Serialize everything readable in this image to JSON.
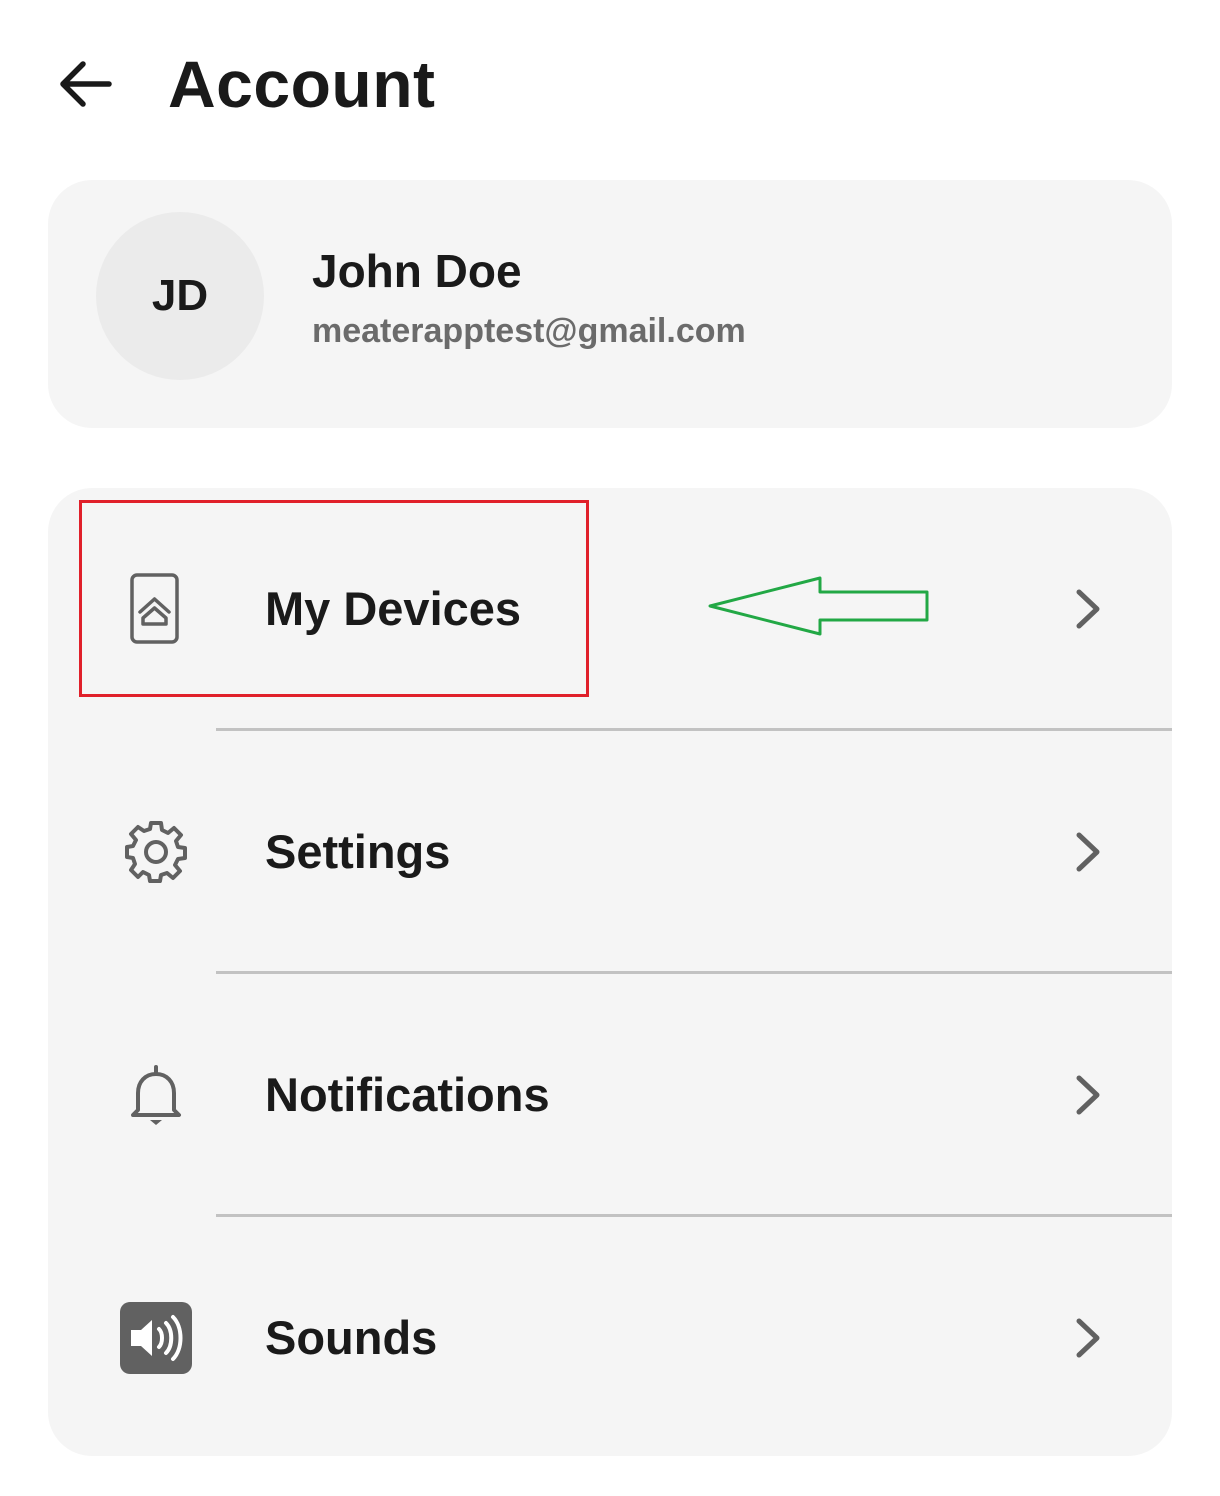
{
  "header": {
    "back_icon": "arrow-left-icon",
    "title": "Account"
  },
  "profile": {
    "initials": "JD",
    "name": "John Doe",
    "email": "meaterapptest@gmail.com"
  },
  "menu": {
    "items": [
      {
        "label": "My Devices",
        "icon": "device-home-icon"
      },
      {
        "label": "Settings",
        "icon": "gear-icon"
      },
      {
        "label": "Notifications",
        "icon": "bell-icon"
      },
      {
        "label": "Sounds",
        "icon": "speaker-icon"
      }
    ]
  },
  "annotations": {
    "highlight_color": "#e0202a",
    "arrow_color": "#22a845"
  },
  "colors": {
    "card_background": "#f5f5f5",
    "text_primary": "#1a1a1a",
    "text_secondary": "#6b6b6b",
    "icon_gray": "#616161"
  }
}
